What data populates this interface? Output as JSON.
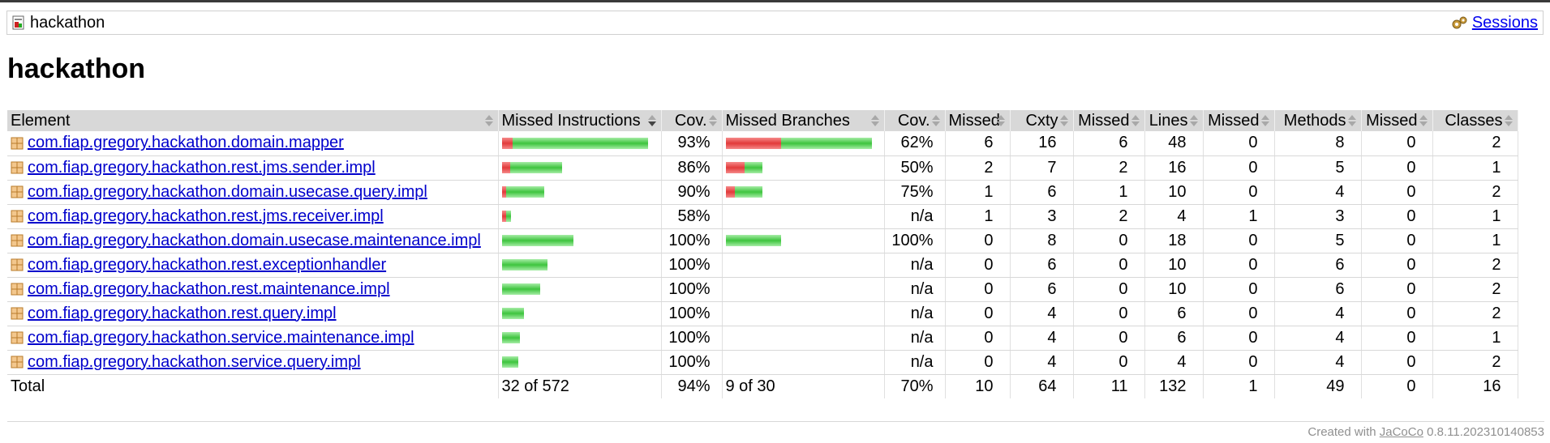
{
  "breadcrumb": {
    "title": "hackathon",
    "sessions_label": "Sessions"
  },
  "page_title": "hackathon",
  "columns": [
    "Element",
    "Missed Instructions",
    "Cov.",
    "Missed Branches",
    "Cov.",
    "Missed",
    "Cxty",
    "Missed",
    "Lines",
    "Missed",
    "Methods",
    "Missed",
    "Classes"
  ],
  "rows": [
    {
      "name": "com.fiap.gregory.hackathon.domain.mapper",
      "instr_missed_frac": 0.07,
      "instr_bar_scale": 1.0,
      "instr_cov": "93%",
      "branch_missed_frac": 0.38,
      "branch_bar_scale": 1.0,
      "branch_cov": "62%",
      "cxty_missed": "6",
      "cxty": "16",
      "lines_missed": "6",
      "lines": "48",
      "methods_missed": "0",
      "methods": "8",
      "classes_missed": "0",
      "classes": "2"
    },
    {
      "name": "com.fiap.gregory.hackathon.rest.jms.sender.impl",
      "instr_missed_frac": 0.14,
      "instr_bar_scale": 0.41,
      "instr_cov": "86%",
      "branch_missed_frac": 0.5,
      "branch_bar_scale": 0.25,
      "branch_cov": "50%",
      "cxty_missed": "2",
      "cxty": "7",
      "lines_missed": "2",
      "lines": "16",
      "methods_missed": "0",
      "methods": "5",
      "classes_missed": "0",
      "classes": "1"
    },
    {
      "name": "com.fiap.gregory.hackathon.domain.usecase.query.impl",
      "instr_missed_frac": 0.1,
      "instr_bar_scale": 0.29,
      "instr_cov": "90%",
      "branch_missed_frac": 0.25,
      "branch_bar_scale": 0.25,
      "branch_cov": "75%",
      "cxty_missed": "1",
      "cxty": "6",
      "lines_missed": "1",
      "lines": "10",
      "methods_missed": "0",
      "methods": "4",
      "classes_missed": "0",
      "classes": "2"
    },
    {
      "name": "com.fiap.gregory.hackathon.rest.jms.receiver.impl",
      "instr_missed_frac": 0.42,
      "instr_bar_scale": 0.06,
      "instr_cov": "58%",
      "branch_missed_frac": 0,
      "branch_bar_scale": 0,
      "branch_cov": "n/a",
      "cxty_missed": "1",
      "cxty": "3",
      "lines_missed": "2",
      "lines": "4",
      "methods_missed": "1",
      "methods": "3",
      "classes_missed": "0",
      "classes": "1"
    },
    {
      "name": "com.fiap.gregory.hackathon.domain.usecase.maintenance.impl",
      "instr_missed_frac": 0,
      "instr_bar_scale": 0.49,
      "instr_cov": "100%",
      "branch_missed_frac": 0,
      "branch_bar_scale": 0.38,
      "branch_cov": "100%",
      "cxty_missed": "0",
      "cxty": "8",
      "lines_missed": "0",
      "lines": "18",
      "methods_missed": "0",
      "methods": "5",
      "classes_missed": "0",
      "classes": "1"
    },
    {
      "name": "com.fiap.gregory.hackathon.rest.exceptionhandler",
      "instr_missed_frac": 0,
      "instr_bar_scale": 0.31,
      "instr_cov": "100%",
      "branch_missed_frac": 0,
      "branch_bar_scale": 0,
      "branch_cov": "n/a",
      "cxty_missed": "0",
      "cxty": "6",
      "lines_missed": "0",
      "lines": "10",
      "methods_missed": "0",
      "methods": "6",
      "classes_missed": "0",
      "classes": "2"
    },
    {
      "name": "com.fiap.gregory.hackathon.rest.maintenance.impl",
      "instr_missed_frac": 0,
      "instr_bar_scale": 0.26,
      "instr_cov": "100%",
      "branch_missed_frac": 0,
      "branch_bar_scale": 0,
      "branch_cov": "n/a",
      "cxty_missed": "0",
      "cxty": "6",
      "lines_missed": "0",
      "lines": "10",
      "methods_missed": "0",
      "methods": "6",
      "classes_missed": "0",
      "classes": "2"
    },
    {
      "name": "com.fiap.gregory.hackathon.rest.query.impl",
      "instr_missed_frac": 0,
      "instr_bar_scale": 0.15,
      "instr_cov": "100%",
      "branch_missed_frac": 0,
      "branch_bar_scale": 0,
      "branch_cov": "n/a",
      "cxty_missed": "0",
      "cxty": "4",
      "lines_missed": "0",
      "lines": "6",
      "methods_missed": "0",
      "methods": "4",
      "classes_missed": "0",
      "classes": "2"
    },
    {
      "name": "com.fiap.gregory.hackathon.service.maintenance.impl",
      "instr_missed_frac": 0,
      "instr_bar_scale": 0.12,
      "instr_cov": "100%",
      "branch_missed_frac": 0,
      "branch_bar_scale": 0,
      "branch_cov": "n/a",
      "cxty_missed": "0",
      "cxty": "4",
      "lines_missed": "0",
      "lines": "6",
      "methods_missed": "0",
      "methods": "4",
      "classes_missed": "0",
      "classes": "1"
    },
    {
      "name": "com.fiap.gregory.hackathon.service.query.impl",
      "instr_missed_frac": 0,
      "instr_bar_scale": 0.11,
      "instr_cov": "100%",
      "branch_missed_frac": 0,
      "branch_bar_scale": 0,
      "branch_cov": "n/a",
      "cxty_missed": "0",
      "cxty": "4",
      "lines_missed": "0",
      "lines": "4",
      "methods_missed": "0",
      "methods": "4",
      "classes_missed": "0",
      "classes": "2"
    }
  ],
  "total": {
    "label": "Total",
    "instr": "32 of 572",
    "instr_cov": "94%",
    "branch": "9 of 30",
    "branch_cov": "70%",
    "cxty_missed": "10",
    "cxty": "64",
    "lines_missed": "11",
    "lines": "132",
    "methods_missed": "1",
    "methods": "49",
    "classes_missed": "0",
    "classes": "16"
  },
  "footer": {
    "prefix": "Created with ",
    "link": "JaCoCo",
    "version": " 0.8.11.202310140853"
  },
  "colors": {
    "bar_red": "#e23a3a",
    "bar_green": "#3ec43e",
    "link": "#0000cc"
  },
  "icons": {
    "report": "report-icon",
    "sessions": "sessions-icon",
    "package": "package-icon"
  }
}
